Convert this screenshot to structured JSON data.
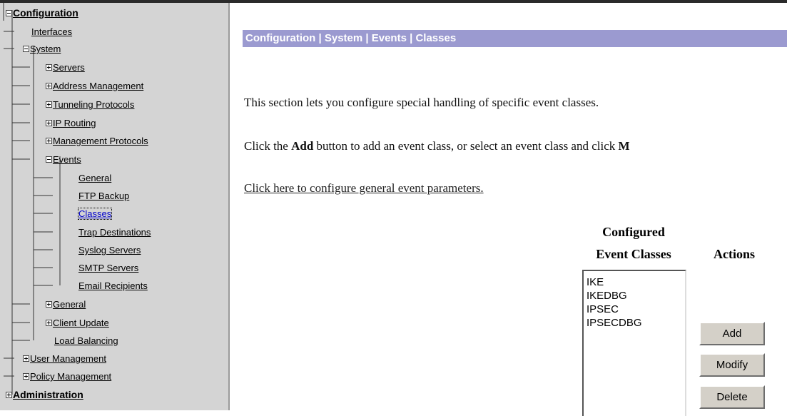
{
  "sidebar": {
    "items": [
      {
        "label": "Configuration",
        "toggle": "minus"
      },
      {
        "label": "Interfaces",
        "toggle": ""
      },
      {
        "label": "System",
        "toggle": "minus"
      },
      {
        "label": "Servers",
        "toggle": "plus"
      },
      {
        "label": "Address Management",
        "toggle": "plus"
      },
      {
        "label": "Tunneling Protocols",
        "toggle": "plus"
      },
      {
        "label": "IP Routing",
        "toggle": "plus"
      },
      {
        "label": "Management Protocols",
        "toggle": "plus"
      },
      {
        "label": "Events",
        "toggle": "minus"
      },
      {
        "label": "General",
        "toggle": ""
      },
      {
        "label": "FTP Backup",
        "toggle": ""
      },
      {
        "label": "Classes",
        "toggle": "",
        "selected": true
      },
      {
        "label": "Trap Destinations",
        "toggle": ""
      },
      {
        "label": "Syslog Servers",
        "toggle": ""
      },
      {
        "label": "SMTP Servers",
        "toggle": ""
      },
      {
        "label": "Email Recipients",
        "toggle": ""
      },
      {
        "label": "General",
        "toggle": "plus"
      },
      {
        "label": "Client Update",
        "toggle": "plus"
      },
      {
        "label": "Load Balancing",
        "toggle": ""
      },
      {
        "label": "User Management",
        "toggle": "plus"
      },
      {
        "label": "Policy Management",
        "toggle": "plus"
      },
      {
        "label": "Administration",
        "toggle": "plus"
      }
    ]
  },
  "main": {
    "title": "Configuration | System | Events | Classes",
    "intro": "This section lets you configure special handling of specific event classes.",
    "instructions_prefix": "Click the ",
    "instructions_bold": "Add",
    "instructions_middle": " button to add an event class, or select an event class and click ",
    "instructions_tail": "M",
    "link": "Click here to configure general event parameters.",
    "list_header_line1": "Configured",
    "list_header_line2": "Event Classes",
    "actions_header": "Actions",
    "event_classes": [
      "IKE",
      "IKEDBG",
      "IPSEC",
      "IPSECDBG"
    ],
    "buttons": {
      "add": "Add",
      "modify": "Modify",
      "delete": "Delete"
    }
  },
  "colors": {
    "title_bar": "#9b9ad0",
    "sidebar_bg": "#d4d4d4",
    "button_face": "#d4d0c8"
  }
}
